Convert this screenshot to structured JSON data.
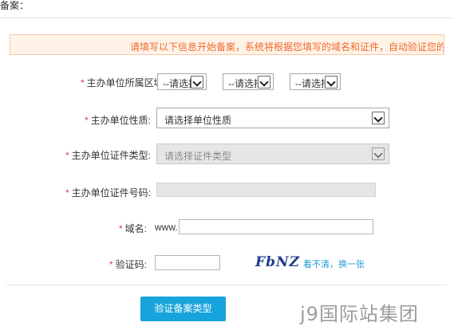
{
  "header": {
    "title": "备案："
  },
  "notice": {
    "text": "请填写以下信息开始备案，系统将根据您填写的域名和证件，自动验证您的备案类型"
  },
  "form": {
    "region": {
      "label": "主办单位所属区域:",
      "selects": [
        {
          "value": "--请选择--"
        },
        {
          "value": "--请选择--"
        },
        {
          "value": "--请选择--"
        }
      ]
    },
    "nature": {
      "label": "主办单位性质:",
      "value": "请选择单位性质"
    },
    "cert_type": {
      "label": "主办单位证件类型:",
      "value": "请选择证件类型"
    },
    "cert_no": {
      "label": "主办单位证件号码:",
      "value": ""
    },
    "domain": {
      "label": "域名:",
      "prefix": "www.",
      "value": ""
    },
    "captcha": {
      "label": "验证码:",
      "value": "",
      "image_text": "FbNZ",
      "refresh_text": "看不清，换一张"
    }
  },
  "actions": {
    "verify_label": "验证备案类型"
  },
  "watermark": {
    "text": "j9国际站集团"
  },
  "colors": {
    "required": "#e4393c",
    "notice": "#ef6a2e",
    "accent": "#17a3dc",
    "captcha": "#1f3b8a"
  }
}
